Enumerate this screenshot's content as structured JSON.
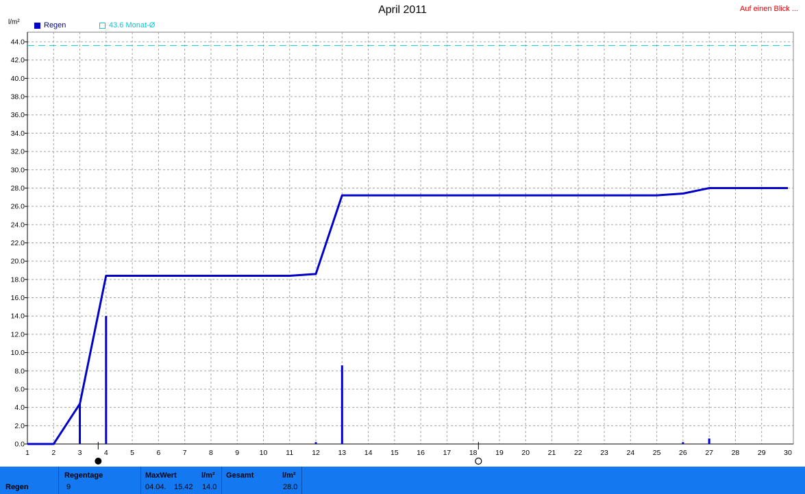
{
  "title": "April 2011",
  "link_label": "Auf einen Blick ...",
  "y_unit": "l/m²",
  "legend": {
    "series1_label": "Regen",
    "series2_label": "43.6 Monat-Ø"
  },
  "colors": {
    "cumulative_line": "#0000c8",
    "daily_bars": "#0000c8",
    "average_line": "#00c8d8",
    "grid": "#a0a0a0",
    "footer_bg": "#1478f0"
  },
  "chart_data": {
    "type": "line",
    "title": "April 2011",
    "ylabel": "l/m²",
    "xlim": [
      1,
      30
    ],
    "ylim": [
      0,
      44
    ],
    "y_ticks": [
      "0.0",
      "2.0",
      "4.0",
      "6.0",
      "8.0",
      "10.0",
      "12.0",
      "14.0",
      "16.0",
      "18.0",
      "20.0",
      "22.0",
      "24.0",
      "26.0",
      "28.0",
      "30.0",
      "32.0",
      "34.0",
      "36.0",
      "38.0",
      "40.0",
      "42.0",
      "44.0"
    ],
    "x_ticks": [
      "1",
      "2",
      "3",
      "4",
      "5",
      "6",
      "7",
      "8",
      "9",
      "10",
      "11",
      "12",
      "13",
      "14",
      "15",
      "16",
      "17",
      "18",
      "19",
      "20",
      "21",
      "22",
      "23",
      "24",
      "25",
      "26",
      "27",
      "28",
      "29",
      "30"
    ],
    "grid": true,
    "series": [
      {
        "name": "Regen",
        "style": "cumulative-line",
        "points": [
          [
            1,
            0.0
          ],
          [
            2,
            0.0
          ],
          [
            3,
            4.4
          ],
          [
            4,
            18.4
          ],
          [
            5,
            18.4
          ],
          [
            6,
            18.4
          ],
          [
            7,
            18.4
          ],
          [
            8,
            18.4
          ],
          [
            9,
            18.4
          ],
          [
            10,
            18.4
          ],
          [
            11,
            18.4
          ],
          [
            12,
            18.6
          ],
          [
            13,
            27.2
          ],
          [
            14,
            27.2
          ],
          [
            15,
            27.2
          ],
          [
            16,
            27.2
          ],
          [
            17,
            27.2
          ],
          [
            18,
            27.2
          ],
          [
            19,
            27.2
          ],
          [
            20,
            27.2
          ],
          [
            21,
            27.2
          ],
          [
            22,
            27.2
          ],
          [
            23,
            27.2
          ],
          [
            24,
            27.2
          ],
          [
            25,
            27.2
          ],
          [
            26,
            27.4
          ],
          [
            27,
            28.0
          ],
          [
            28,
            28.0
          ],
          [
            29,
            28.0
          ],
          [
            30,
            28.0
          ]
        ]
      },
      {
        "name": "Regen",
        "style": "daily-bars",
        "points": [
          [
            3,
            4.4
          ],
          [
            4,
            14.0
          ],
          [
            12,
            0.2
          ],
          [
            13,
            8.6
          ],
          [
            26,
            0.2
          ],
          [
            27,
            0.6
          ]
        ]
      }
    ],
    "reference_line": {
      "name": "43.6 Monat-Ø",
      "value": 43.6
    },
    "moon_markers": [
      {
        "type": "new-moon",
        "day": 3.7
      },
      {
        "type": "full-moon",
        "day": 18.2
      }
    ]
  },
  "footer": {
    "row_label": "Regen",
    "regentage": {
      "header": "Regentage",
      "value": "9"
    },
    "maxwert": {
      "header": "MaxWert",
      "unit": "l/m²",
      "date": "04.04.",
      "time": "15.42",
      "value": "14.0"
    },
    "gesamt": {
      "header": "Gesamt",
      "unit": "l/m²",
      "value": "28.0"
    }
  }
}
